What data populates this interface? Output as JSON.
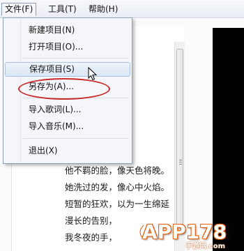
{
  "menubar": {
    "file": "文件(F)",
    "tools": "工具(T)",
    "help": "帮助(H)"
  },
  "file_menu": {
    "new_project": "新建项目(N)",
    "open_project": "打开项目(O)...",
    "save_project": "保存项目(S)",
    "save_as": "另存为(A)...",
    "import_lyrics": "导入歌词(L)...",
    "import_music": "导入音乐(M)...",
    "exit": "退出(X)"
  },
  "lyrics": [
    "他不羁的脸，像天色将晚。",
    "她洗过的发，像心中火焰。",
    "短暂的狂欢，以为一生绵延",
    "漫长的告别，",
    "我冬夜的手，"
  ],
  "watermark": {
    "logo": "APP178",
    "sub": "手游网.com"
  },
  "colors": {
    "annotation": "#c92a2a",
    "watermark_orange": "#e65a00"
  },
  "icons": [
    "mouse-cursor-icon",
    "scroll-grip-icon"
  ]
}
